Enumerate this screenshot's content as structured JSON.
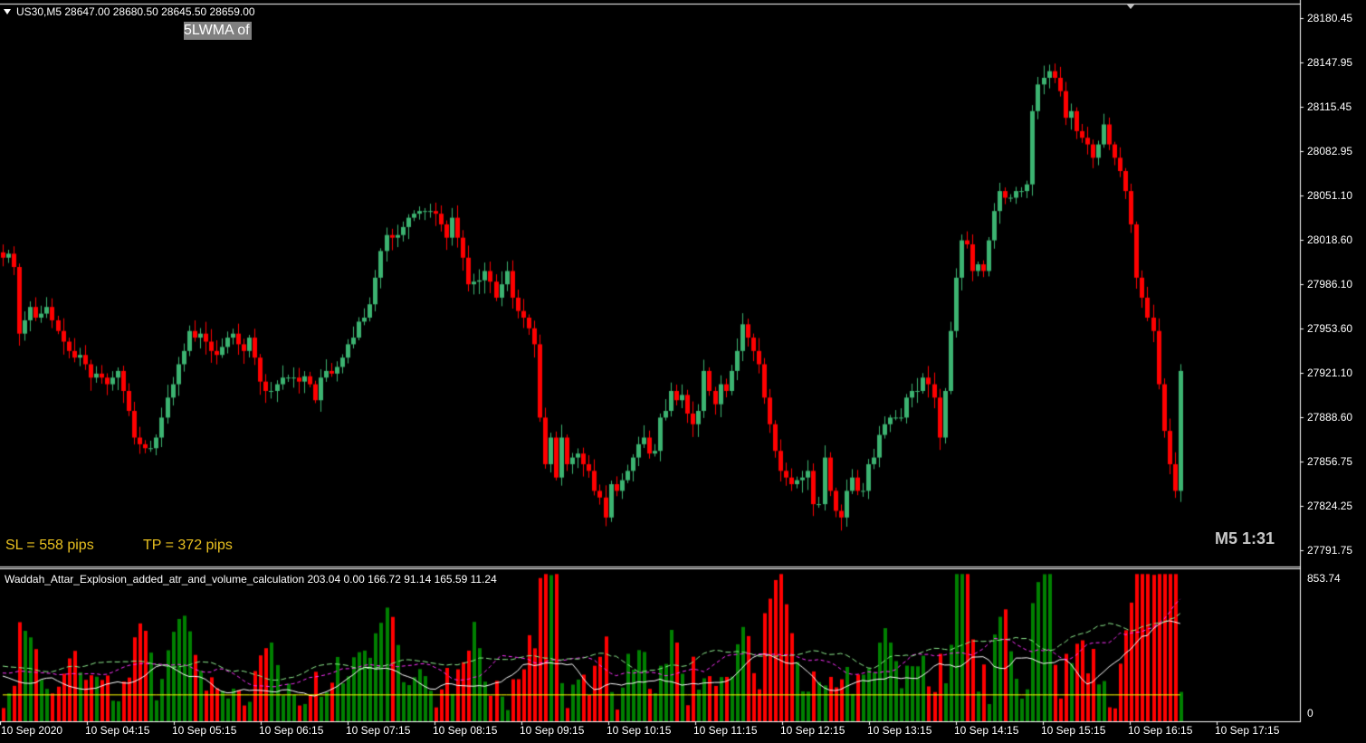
{
  "window": {
    "title": "US30,M5  28647.00 28680.50 28645.50 28659.00",
    "overlay_label": "5LWMA of",
    "sl_text": "SL = 558 pips",
    "tp_text": "TP = 372 pips",
    "timeframe_clock": "M5 1:31",
    "indicator_label": "Waddah_Attar_Explosion_added_atr_and_volume_calculation 203.04 0.00 166.72 91.14 165.59 11.24"
  },
  "colors": {
    "background": "#000000",
    "bull": "#3cb371",
    "bear": "#ff0000",
    "indicator_up": "#008000",
    "indicator_down": "#ff0000",
    "sl_tp_text": "#e8c020",
    "panel_border": "#ffffff"
  },
  "price_axis": {
    "ticks": [
      "28180.45",
      "28147.95",
      "28115.45",
      "28082.95",
      "28051.10",
      "28018.60",
      "27986.10",
      "27953.60",
      "27921.10",
      "27888.60",
      "27856.75",
      "27824.25",
      "27791.75"
    ]
  },
  "indicator_axis": {
    "ticks": [
      "853.74",
      "0"
    ]
  },
  "time_axis": {
    "ticks": [
      "10 Sep 2020",
      "10 Sep 04:15",
      "10 Sep 05:15",
      "10 Sep 06:15",
      "10 Sep 07:15",
      "10 Sep 08:15",
      "10 Sep 09:15",
      "10 Sep 10:15",
      "10 Sep 11:15",
      "10 Sep 12:15",
      "10 Sep 13:15",
      "10 Sep 14:15",
      "10 Sep 15:15",
      "10 Sep 16:15",
      "10 Sep 17:15"
    ]
  },
  "chart_data": {
    "type": "candlestick",
    "symbol": "US30",
    "timeframe": "M5",
    "price_range": [
      27780,
      28195
    ],
    "closes": [
      28005,
      28008,
      27998,
      27948,
      27958,
      27968,
      27960,
      27963,
      27968,
      27958,
      27950,
      27942,
      27935,
      27930,
      27932,
      27925,
      27915,
      27918,
      27915,
      27910,
      27915,
      27920,
      27905,
      27890,
      27870,
      27865,
      27862,
      27862,
      27870,
      27885,
      27900,
      27910,
      27925,
      27935,
      27950,
      27945,
      27948,
      27942,
      27935,
      27932,
      27938,
      27945,
      27948,
      27940,
      27935,
      27945,
      27930,
      27912,
      27905,
      27905,
      27910,
      27915,
      27915,
      27915,
      27912,
      27916,
      27910,
      27898,
      27915,
      27920,
      27918,
      27923,
      27930,
      27940,
      27945,
      27957,
      27960,
      27970,
      27990,
      28010,
      28022,
      28020,
      28022,
      28028,
      28035,
      28038,
      28040,
      28040,
      28040,
      28038,
      28030,
      28020,
      28035,
      28020,
      28005,
      27985,
      27987,
      27988,
      27995,
      27987,
      27975,
      27985,
      27995,
      27975,
      27965,
      27960,
      27952,
      27940,
      27885,
      27850,
      27870,
      27840,
      27870,
      27850,
      27855,
      27858,
      27850,
      27845,
      27830,
      27825,
      27810,
      27835,
      27830,
      27838,
      27845,
      27855,
      27865,
      27870,
      27858,
      27860,
      27885,
      27890,
      27905,
      27898,
      27902,
      27888,
      27880,
      27890,
      27920,
      27905,
      27895,
      27910,
      27905,
      27920,
      27935,
      27955,
      27945,
      27935,
      27925,
      27900,
      27880,
      27860,
      27845,
      27840,
      27835,
      27838,
      27840,
      27845,
      27820,
      27820,
      27855,
      27830,
      27815,
      27810,
      27830,
      27840,
      27830,
      27830,
      27850,
      27855,
      27872,
      27880,
      27885,
      27885,
      27885,
      27900,
      27905,
      27905,
      27915,
      27910,
      27900,
      27870,
      27905,
      27950,
      27990,
      28018,
      28015,
      27995,
      28000,
      27995,
      28018,
      28040,
      28055,
      28050,
      28050,
      28055,
      28055,
      28060,
      28115,
      28135,
      28140,
      28145,
      28140,
      28130,
      28110,
      28115,
      28100,
      28095,
      28090,
      28080,
      28090,
      28105,
      28090,
      28080,
      28070,
      28055,
      28030,
      27990,
      27975,
      27960,
      27950,
      27910,
      27875,
      27850,
      27830,
      27920
    ],
    "indicator": {
      "name": "Waddah_Attar_Explosion_added_atr_and_volume_calculation",
      "values_shown": [
        203.04,
        0.0,
        166.72,
        91.14,
        165.59,
        11.24
      ],
      "range": [
        0,
        853.74
      ]
    }
  }
}
